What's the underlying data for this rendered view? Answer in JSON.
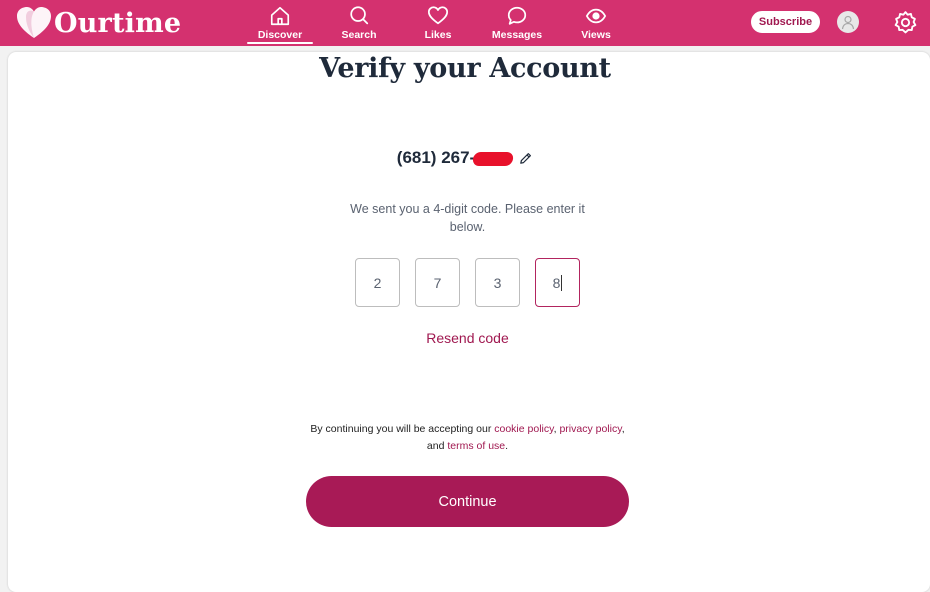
{
  "header": {
    "logo_text": "Ourtime",
    "nav": [
      {
        "label": "Discover",
        "icon": "home-icon",
        "active": true
      },
      {
        "label": "Search",
        "icon": "search-icon",
        "active": false
      },
      {
        "label": "Likes",
        "icon": "heart-icon",
        "active": false
      },
      {
        "label": "Messages",
        "icon": "chat-bubble-icon",
        "active": false
      },
      {
        "label": "Views",
        "icon": "eye-icon",
        "active": false
      }
    ],
    "subscribe_label": "Subscribe",
    "colors": {
      "brand": "#d4316f",
      "accent": "#a81a56"
    }
  },
  "main": {
    "title": "Verify your Account",
    "phone_visible": "(681) 267-",
    "instructions": "We sent you a 4-digit code. Please enter it below.",
    "code_digits": [
      "2",
      "7",
      "3",
      "8"
    ],
    "resend_label": "Resend code",
    "legal": {
      "prefix": "By continuing you will be accepting our ",
      "cookie_link": "cookie policy",
      "sep1": ", ",
      "privacy_link": "privacy policy",
      "sep2": ", and ",
      "terms_link": "terms of use",
      "suffix": "."
    },
    "continue_label": "Continue"
  }
}
